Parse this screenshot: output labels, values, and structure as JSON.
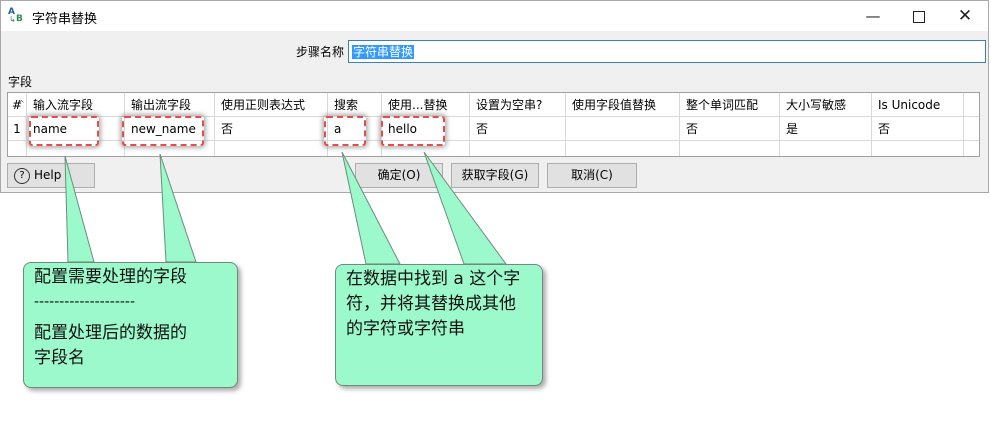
{
  "window": {
    "title": "字符串替换",
    "minimize": "—",
    "close": "✕"
  },
  "form": {
    "step_name_label": "步骤名称",
    "step_name_value": "字符串替换",
    "fields_label": "字段"
  },
  "table": {
    "columns": [
      "#",
      "输入流字段",
      "输出流字段",
      "使用正则表达式",
      "搜索",
      "使用...替换",
      "设置为空串?",
      "使用字段值替换",
      "整个单词匹配",
      "大小写敏感",
      "Is Unicode"
    ],
    "rows": [
      [
        "1",
        "name",
        "new_name",
        "否",
        "a",
        "hello",
        "否",
        "",
        "否",
        "是",
        "否"
      ]
    ]
  },
  "buttons": {
    "help": "Help",
    "ok": "确定(O)",
    "get_fields": "获取字段(G)",
    "cancel": "取消(C)"
  },
  "annotations": {
    "callout1": {
      "line1": "配置需要处理的字段",
      "line2": "--------------------",
      "line3": "配置处理后的数据的",
      "line4": "字段名"
    },
    "callout2": {
      "text": "在数据中找到 a  这个字符，并将其替换成其他的字符或字符串"
    },
    "colors": {
      "callout_fill": "#9cf9cb",
      "highlight_border": "#e84b4b",
      "selection": "#3399ff"
    }
  }
}
